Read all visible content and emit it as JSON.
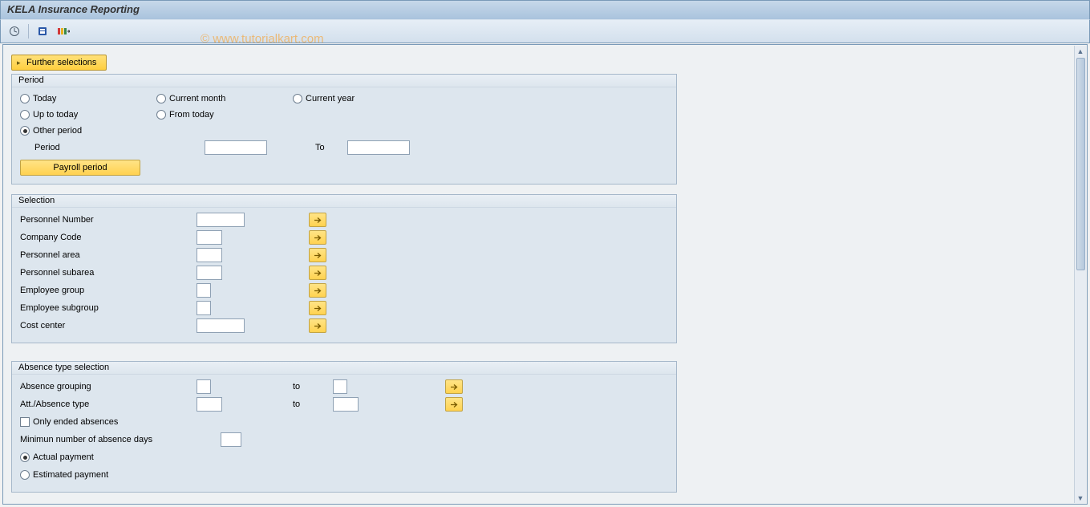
{
  "title": "KELA Insurance Reporting",
  "watermark": "© www.tutorialkart.com",
  "toolbar": {
    "execute_icon": "execute-icon",
    "orgstruct_icon": "orgstructure-icon",
    "search_icon": "search-help-icon"
  },
  "buttons": {
    "further_selections": "Further selections",
    "payroll_period": "Payroll period"
  },
  "period": {
    "group_title": "Period",
    "today": "Today",
    "current_month": "Current month",
    "current_year": "Current year",
    "up_to_today": "Up to today",
    "from_today": "From today",
    "other_period": "Other period",
    "period_label": "Period",
    "to_label": "To",
    "from_value": "",
    "to_value": "",
    "selected": "other_period"
  },
  "selection": {
    "group_title": "Selection",
    "fields": [
      {
        "label": "Personnel Number",
        "width": "w-60",
        "value": ""
      },
      {
        "label": "Company Code",
        "width": "w-32",
        "value": ""
      },
      {
        "label": "Personnel area",
        "width": "w-32",
        "value": ""
      },
      {
        "label": "Personnel subarea",
        "width": "w-32",
        "value": ""
      },
      {
        "label": "Employee group",
        "width": "w-18",
        "value": ""
      },
      {
        "label": "Employee subgroup",
        "width": "w-18",
        "value": ""
      },
      {
        "label": "Cost center",
        "width": "w-60",
        "value": ""
      }
    ]
  },
  "absence": {
    "group_title": "Absence type selection",
    "absence_grouping": "Absence grouping",
    "att_abs_type": "Att./Absence type",
    "to_label": "to",
    "only_ended": "Only ended absences",
    "min_days": "Minimun number of absence days",
    "actual_payment": "Actual payment",
    "estimated_payment": "Estimated payment",
    "grouping_from": "",
    "grouping_to": "",
    "type_from": "",
    "type_to": "",
    "only_ended_checked": false,
    "min_days_value": "",
    "payment_selected": "actual"
  }
}
